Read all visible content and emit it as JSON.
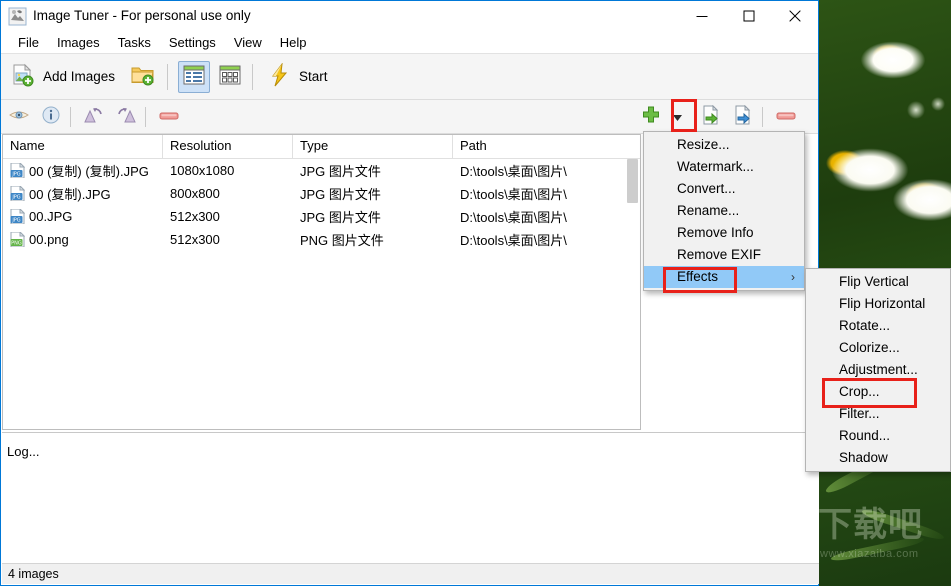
{
  "window": {
    "title": "Image Tuner - For personal use only",
    "app_icon": "app-icon",
    "controls": {
      "minimize": "minimize",
      "maximize": "maximize",
      "close": "close"
    }
  },
  "menubar": {
    "items": [
      {
        "label": "File"
      },
      {
        "label": "Images"
      },
      {
        "label": "Tasks"
      },
      {
        "label": "Settings"
      },
      {
        "label": "View"
      },
      {
        "label": "Help"
      }
    ]
  },
  "toolbar": {
    "add_images_label": "Add Images",
    "add_folder_icon": "add-folder-icon",
    "details_view_icon": "details-view-icon",
    "thumbnail_view_icon": "thumbnail-view-icon",
    "start_label": "Start",
    "start_icon": "lightning-icon"
  },
  "toolbar2": {
    "preview_icon": "eye-icon",
    "info_icon": "info-icon",
    "rotate_left_icon": "rotate-left-icon",
    "rotate_right_icon": "rotate-right-icon",
    "remove_icon": "remove-icon",
    "add_task_icon": "plus-icon",
    "dropdown_icon": "chevron-down-icon",
    "import_icon": "import-task-icon",
    "export_icon": "export-task-icon",
    "delete_task_icon": "delete-task-icon"
  },
  "list": {
    "columns": [
      "Name",
      "Resolution",
      "Type",
      "Path"
    ],
    "rows": [
      {
        "icon": "jpg-file-icon",
        "name": "00 (复制) (复制).JPG",
        "resolution": "1080x1080",
        "type": "JPG 图片文件",
        "path": "D:\\tools\\桌面\\图片\\"
      },
      {
        "icon": "jpg-file-icon",
        "name": "00 (复制).JPG",
        "resolution": "800x800",
        "type": "JPG 图片文件",
        "path": "D:\\tools\\桌面\\图片\\"
      },
      {
        "icon": "jpg-file-icon",
        "name": "00.JPG",
        "resolution": "512x300",
        "type": "JPG 图片文件",
        "path": "D:\\tools\\桌面\\图片\\"
      },
      {
        "icon": "png-file-icon",
        "name": "00.png",
        "resolution": "512x300",
        "type": "PNG 图片文件",
        "path": "D:\\tools\\桌面\\图片\\"
      }
    ]
  },
  "log": {
    "label": "Log..."
  },
  "statusbar": {
    "text": "4 images"
  },
  "context_menu": {
    "items": [
      {
        "label": "Resize...",
        "selected": false
      },
      {
        "label": "Watermark...",
        "selected": false
      },
      {
        "label": "Convert...",
        "selected": false
      },
      {
        "label": "Rename...",
        "selected": false
      },
      {
        "label": "Remove Info",
        "selected": false
      },
      {
        "label": "Remove EXIF",
        "selected": false
      },
      {
        "label": "Effects",
        "selected": true,
        "submenu": true,
        "chevron": "›"
      }
    ]
  },
  "submenu": {
    "items": [
      {
        "label": "Flip Vertical"
      },
      {
        "label": "Flip Horizontal"
      },
      {
        "label": "Rotate..."
      },
      {
        "label": "Colorize..."
      },
      {
        "label": "Adjustment..."
      },
      {
        "label": "Crop..."
      },
      {
        "label": "Filter..."
      },
      {
        "label": "Round..."
      },
      {
        "label": "Shadow"
      }
    ]
  },
  "annotations": {
    "highlight_color": "#e8211a",
    "boxes": [
      "dropdown-arrow",
      "effects-menu-item",
      "crop-menu-item"
    ]
  },
  "wallpaper": {
    "watermark": "下载吧",
    "watermark_url": "www.xiazaiba.com"
  }
}
